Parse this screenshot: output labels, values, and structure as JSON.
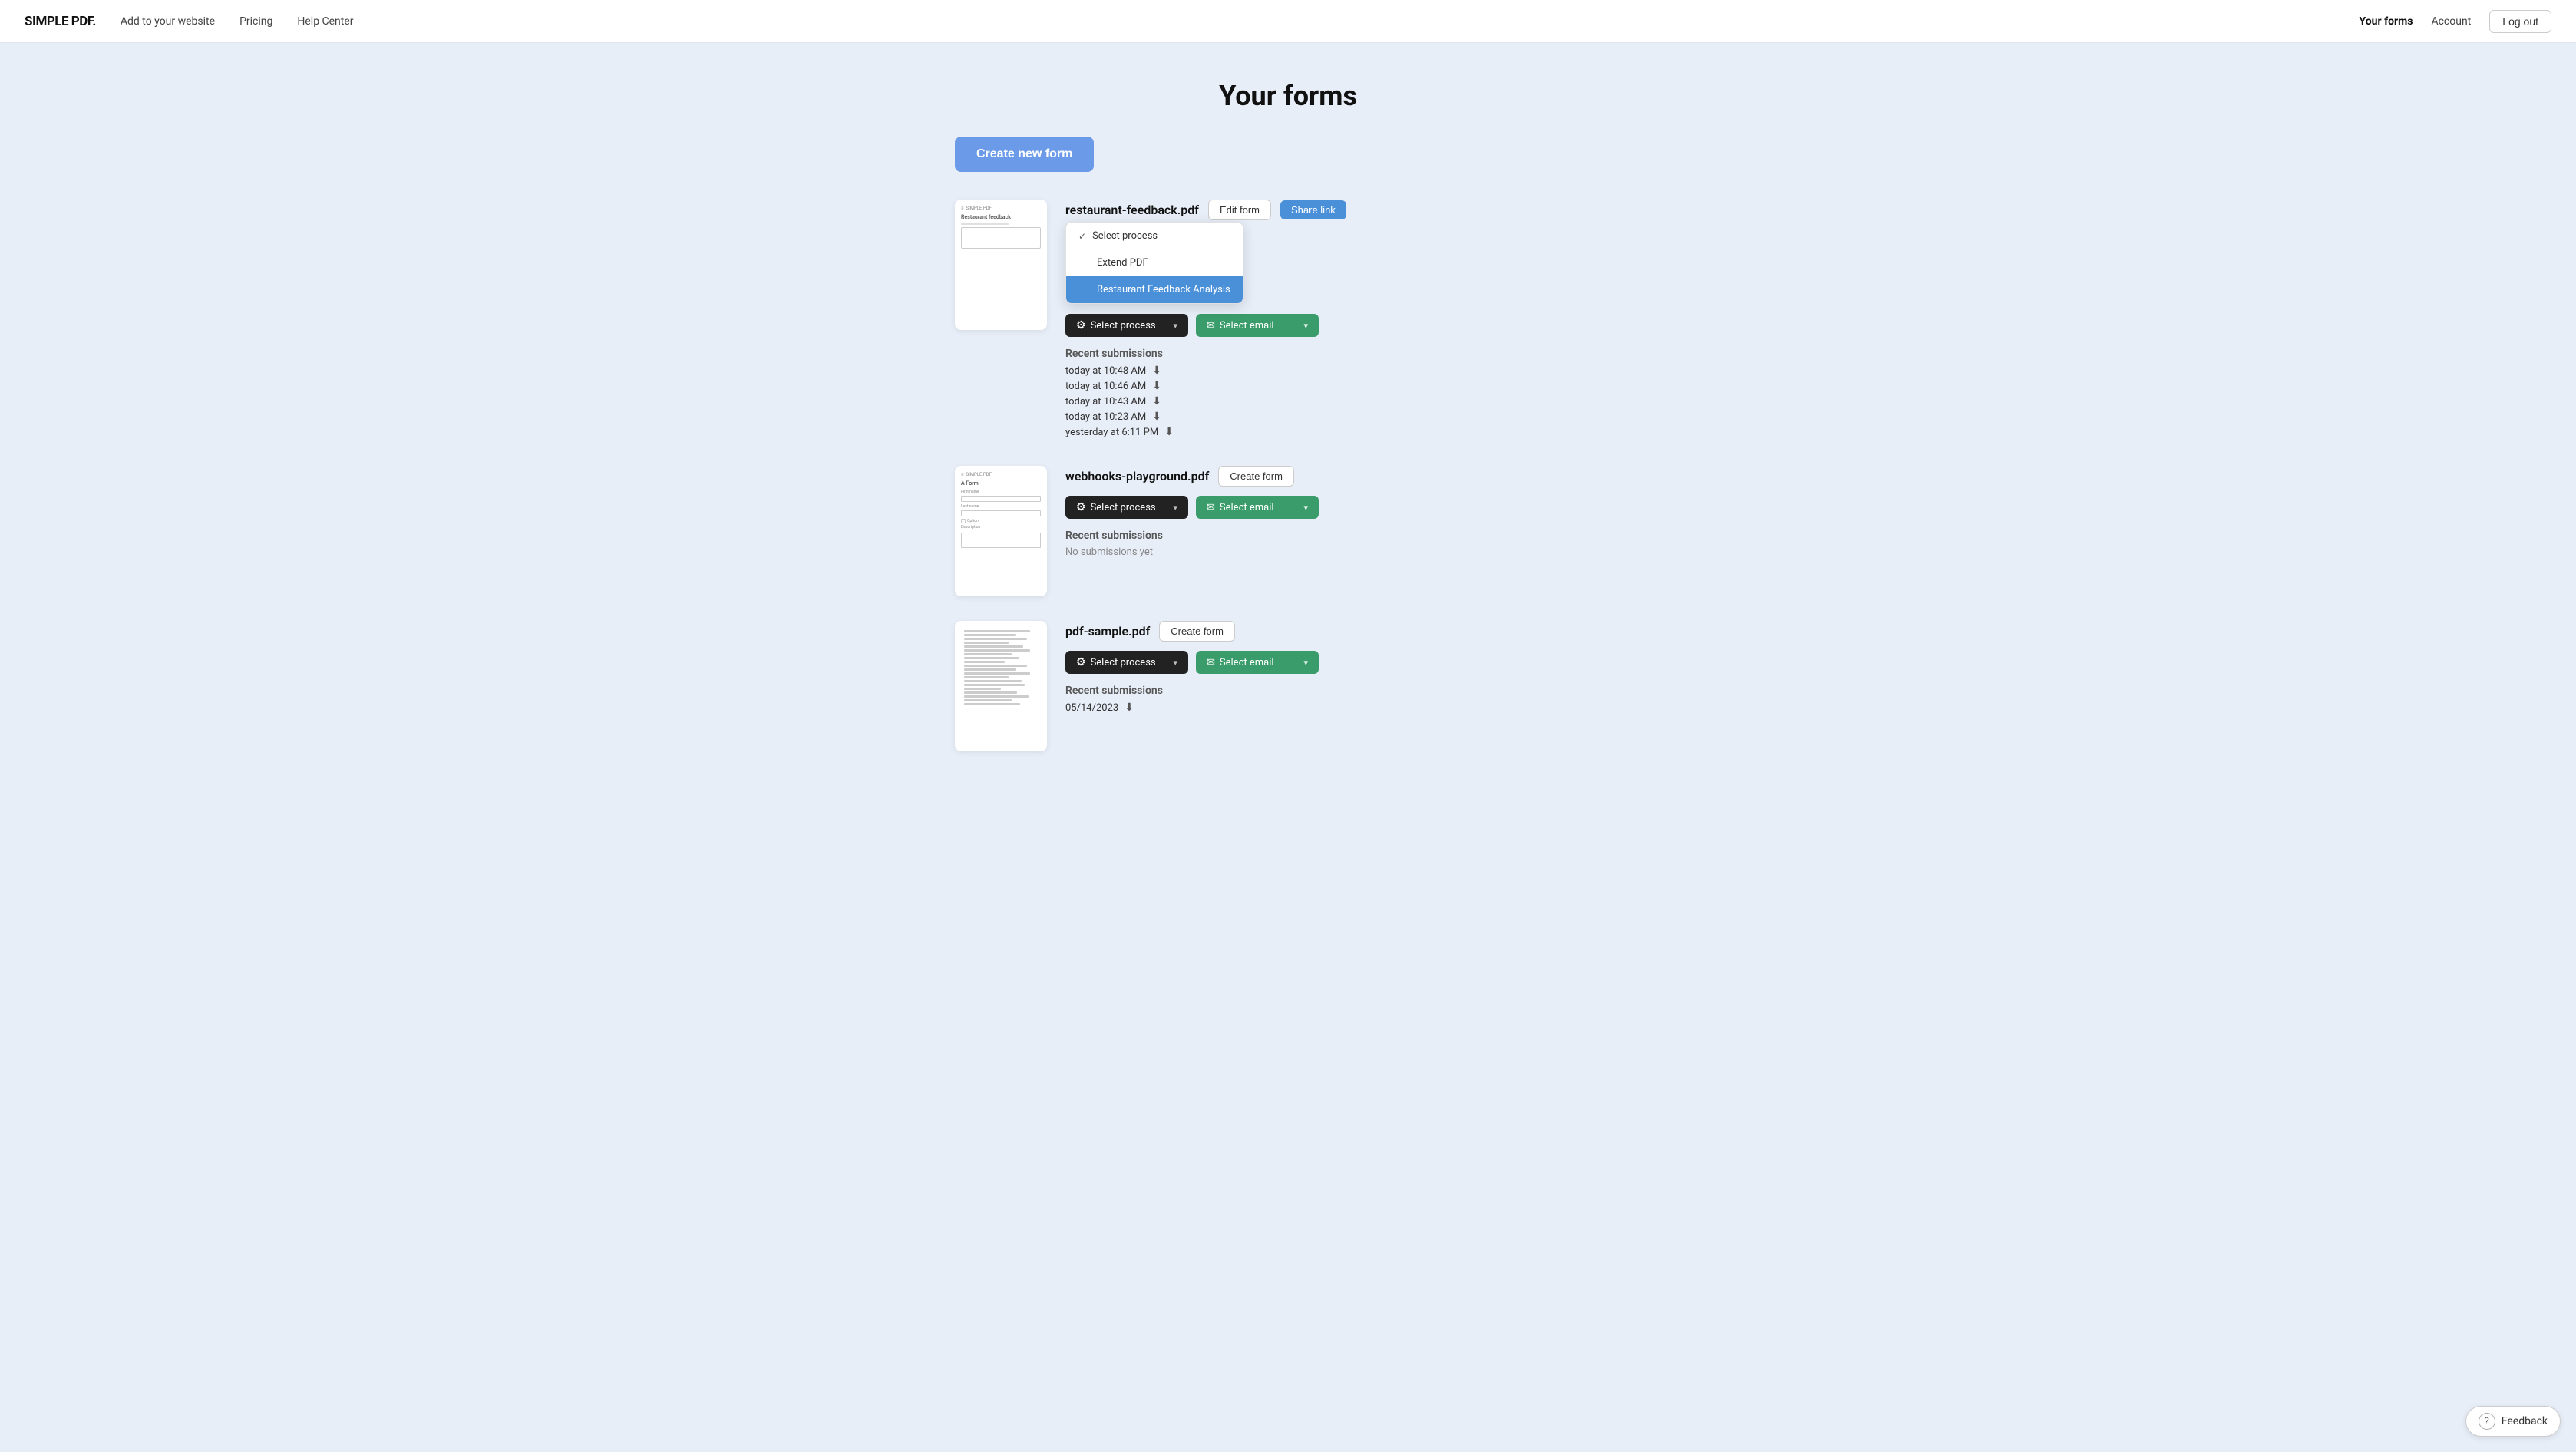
{
  "app": {
    "logo": "SIMPLE PDF.",
    "nav": {
      "add_to_website": "Add to your website",
      "pricing": "Pricing",
      "help_center": "Help Center",
      "your_forms": "Your forms",
      "account": "Account",
      "logout": "Log out"
    }
  },
  "page": {
    "title": "Your forms",
    "create_button": "Create new form"
  },
  "forms": [
    {
      "id": "restaurant-feedback",
      "filename": "restaurant-feedback.pdf",
      "has_form": true,
      "edit_label": "Edit form",
      "share_label": "Share link",
      "process_label": "Select process",
      "email_label": "Select email",
      "dropdown_open": true,
      "dropdown_items": [
        {
          "label": "Select process",
          "type": "checked"
        },
        {
          "label": "Extend PDF",
          "type": "normal"
        },
        {
          "label": "Restaurant Feedback Analysis",
          "type": "highlighted"
        }
      ],
      "submissions_label": "Recent submissions",
      "submissions": [
        {
          "time": "today at 10:48 AM"
        },
        {
          "time": "today at 10:46 AM"
        },
        {
          "time": "today at 10:43 AM"
        },
        {
          "time": "today at 10:23 AM"
        },
        {
          "time": "yesterday at 6:11 PM"
        }
      ],
      "thumb_type": "restaurant"
    },
    {
      "id": "webhooks-playground",
      "filename": "webhooks-playground.pdf",
      "has_form": false,
      "create_label": "Create form",
      "process_label": "Select process",
      "email_label": "Select email",
      "dropdown_open": false,
      "submissions_label": "Recent submissions",
      "no_submissions": "No submissions yet",
      "thumb_type": "form"
    },
    {
      "id": "pdf-sample",
      "filename": "pdf-sample.pdf",
      "has_form": false,
      "create_label": "Create form",
      "process_label": "Select process",
      "email_label": "Select email",
      "dropdown_open": false,
      "submissions_label": "Recent submissions",
      "submissions": [
        {
          "time": "05/14/2023"
        }
      ],
      "thumb_type": "document"
    }
  ],
  "feedback": {
    "label": "Feedback"
  }
}
